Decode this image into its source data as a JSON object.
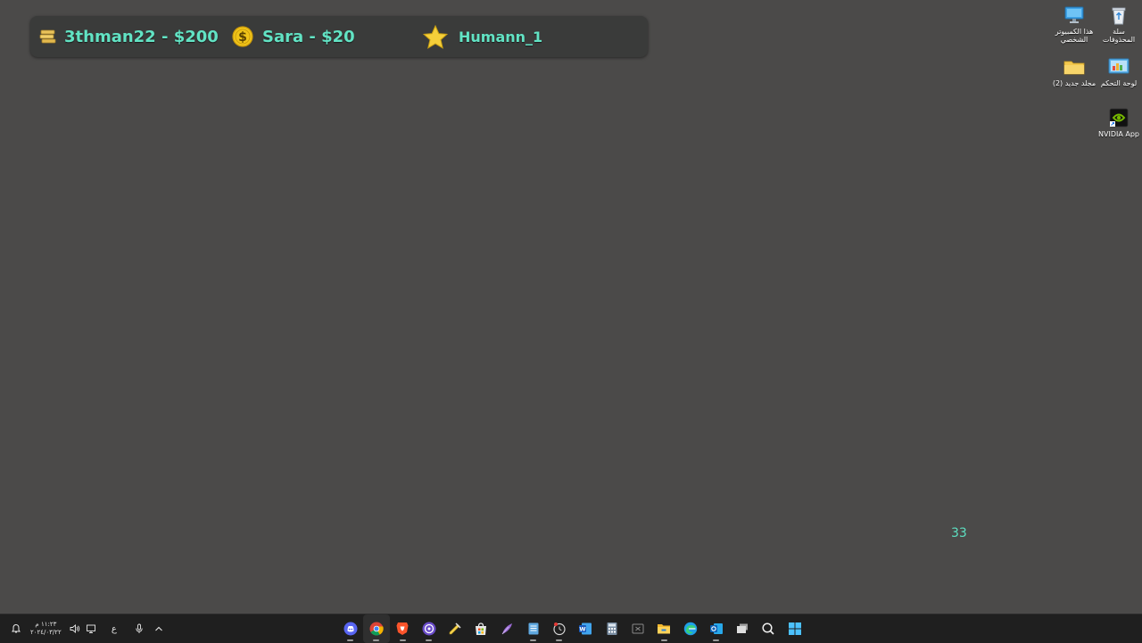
{
  "donations": [
    {
      "icon": "gold-bars-icon",
      "text": "3thman22 - $200"
    },
    {
      "icon": "dollar-coin-icon",
      "text": "Sara - $20"
    },
    {
      "icon": "star-icon",
      "text": "Humann_1"
    }
  ],
  "counter": "33",
  "desktop_icons": [
    {
      "name": "recycle-bin",
      "label": "سلة المحذوفات",
      "icon": "recycle-bin-icon"
    },
    {
      "name": "this-pc",
      "label": "هذا الكمبيوتر الشخصي",
      "icon": "monitor-icon"
    },
    {
      "name": "control-panel",
      "label": "لوحة التحكم",
      "icon": "control-panel-icon"
    },
    {
      "name": "new-folder",
      "label": "(2) مجلد جديد",
      "icon": "folder-icon"
    },
    {
      "name": "nvidia-app",
      "label": "NVIDIA App",
      "icon": "nvidia-icon"
    }
  ],
  "tray": {
    "clock_time": "١١:٢٣ م",
    "clock_date": "٢٠٢٤/٠٣/٢٢",
    "language": "ع"
  },
  "taskbar_apps": [
    "discord-icon",
    "chrome-icon",
    "brave-icon",
    "obs-icon",
    "notes-icon",
    "store-icon",
    "feather-icon",
    "notepad-icon",
    "clock-icon",
    "word-icon",
    "calculator-icon",
    "excel-icon",
    "file-explorer-icon",
    "edge-icon",
    "outlook-icon",
    "task-view-icon",
    "search-icon",
    "start-icon"
  ],
  "colors": {
    "desktop_bg": "#4b4a49",
    "overlay_text": "#62e3c4",
    "taskbar_bg": "#1f1f1f"
  }
}
